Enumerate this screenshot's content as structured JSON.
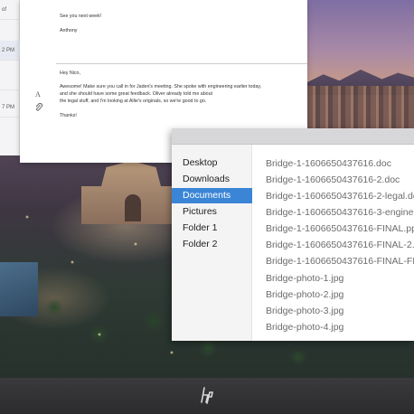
{
  "left_panel": {
    "items": [
      {
        "label": "of"
      },
      {
        "label": "2 PM"
      },
      {
        "label": "7 PM"
      }
    ]
  },
  "email": {
    "prev_signoff": "See you next week!",
    "prev_signature": "Anthony",
    "greeting": "Hey Nico,",
    "body_lines": [
      "Awesome! Make sure you call in for Jaden's meeting. She spoke with engineering earlier today,",
      "and she should have some great feedback. Oliver already told me about",
      "the legal stuff, and I'm looking at Allie's originals, so we're good to go."
    ],
    "closing": "Thanks!",
    "format_icon": "A",
    "attach_icon": "paperclip-icon"
  },
  "file_browser": {
    "sidebar": [
      {
        "label": "Desktop",
        "active": false
      },
      {
        "label": "Downloads",
        "active": false
      },
      {
        "label": "Documents",
        "active": true
      },
      {
        "label": "Pictures",
        "active": false
      },
      {
        "label": "Folder 1",
        "active": false
      },
      {
        "label": "Folder 2",
        "active": false
      }
    ],
    "files": [
      "Bridge-1-1606650437616.doc",
      "Bridge-1-1606650437616-2.doc",
      "Bridge-1-1606650437616-2-legal.doc",
      "Bridge-1-1606650437616-3-engineering.doc",
      "Bridge-1-1606650437616-FINAL.ppt",
      "Bridge-1-1606650437616-FINAL-2.ppt",
      "Bridge-1-1606650437616-FINAL-FINAL.ppt",
      "Bridge-photo-1.jpg",
      "Bridge-photo-2.jpg",
      "Bridge-photo-3.jpg",
      "Bridge-photo-4.jpg"
    ],
    "accent_color": "#3b85d6"
  },
  "monitor": {
    "logo_icon": "hp-logo-icon"
  }
}
